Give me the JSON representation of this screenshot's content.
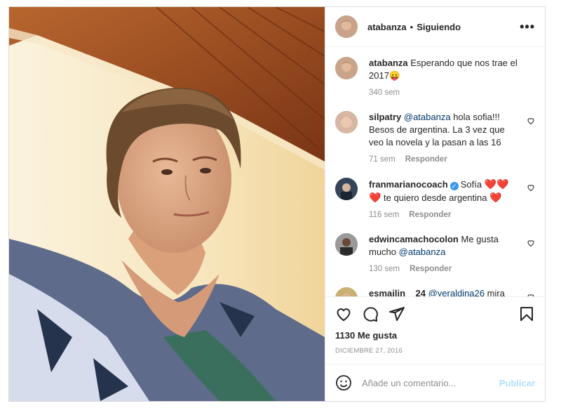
{
  "header": {
    "username": "atabanza",
    "separator": "•",
    "follow_label": "Siguiendo",
    "more_icon": "more-horizontal-icon"
  },
  "caption": {
    "username": "atabanza",
    "text": "Esperando que nos trae el 2017😛",
    "time": "340 sem"
  },
  "comments": [
    {
      "username": "silpatry",
      "mention": "@atabanza",
      "text": " hola sofia!!! Besos de argentina. La 3 vez que veo la novela y la pasan a las 16",
      "time": "71 sem",
      "reply": "Responder"
    },
    {
      "username": "franmarianocoach",
      "verified": true,
      "text": "Sofía ",
      "hearts": "❤️❤️❤️",
      "text2": " te quiero desde argentina ",
      "heart_end": "❤️",
      "time": "116 sem",
      "reply": "Responder"
    },
    {
      "username": "edwincamachocolon",
      "text": "Me gusta mucho ",
      "mention": "@atabanza",
      "time": "130 sem",
      "reply": "Responder"
    },
    {
      "username": "esmailin__24",
      "mention": "@yeraldina26",
      "text": " mira"
    }
  ],
  "actions": {
    "like_icon": "heart-icon",
    "comment_icon": "comment-icon",
    "share_icon": "paper-plane-icon",
    "save_icon": "bookmark-icon"
  },
  "likes": "1130 Me gusta",
  "date": "DICIEMBRE 27, 2016",
  "add_comment": {
    "placeholder": "Añade un comentario...",
    "post_label": "Publicar",
    "emoji_icon": "emoji-icon"
  },
  "colors": {
    "link": "#00376b",
    "muted": "#8e8e8e",
    "post_disabled": "#b2dffc",
    "verified": "#3897f0"
  }
}
